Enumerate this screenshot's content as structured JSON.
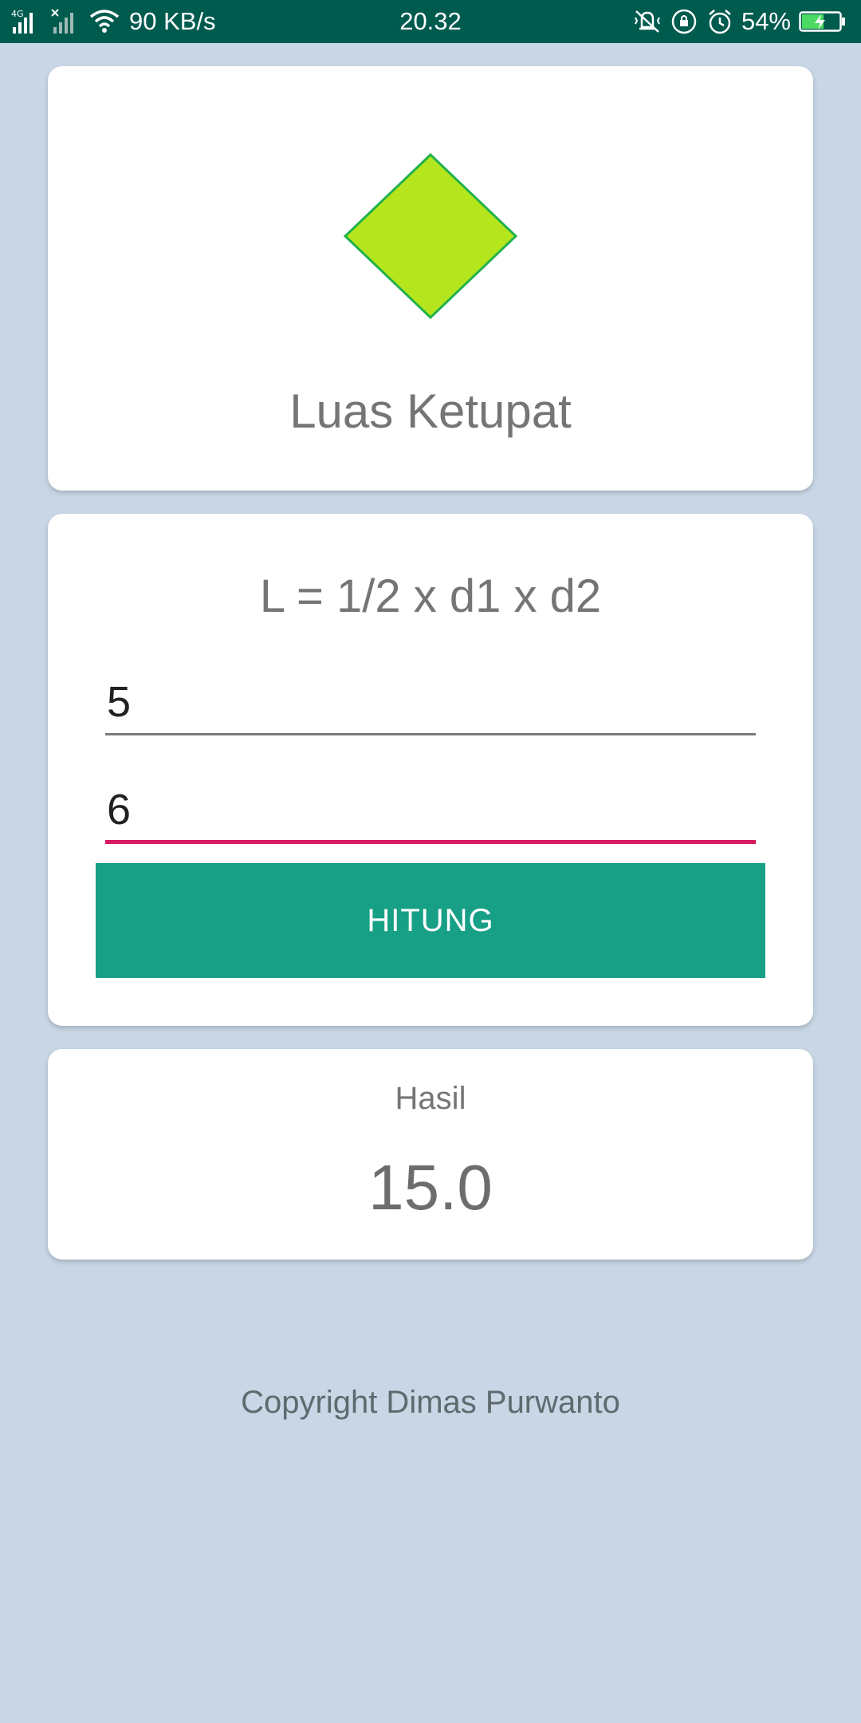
{
  "status_bar": {
    "network": "4G",
    "speed": "90 KB/s",
    "time": "20.32",
    "battery": "54%",
    "icons": [
      "signal-icon",
      "no-signal-icon",
      "wifi-icon",
      "vibrate-icon",
      "rotation-lock-icon",
      "alarm-icon",
      "battery-charging-icon"
    ]
  },
  "header": {
    "title": "Luas Ketupat",
    "shape_icon": "rhombus-icon",
    "shape_fill": "#b5e61d",
    "shape_stroke": "#22b14c"
  },
  "form": {
    "formula": "L = 1/2 x d1 x d2",
    "d1_value": "5",
    "d2_value": "6",
    "button_label": "HITUNG"
  },
  "result": {
    "label": "Hasil",
    "value": "15.0"
  },
  "footer": {
    "copyright": "Copyright Dimas Purwanto"
  },
  "colors": {
    "status_bar": "#005b4f",
    "background": "#c8d6e5",
    "button": "#17a086",
    "active_underline": "#d81b60"
  }
}
